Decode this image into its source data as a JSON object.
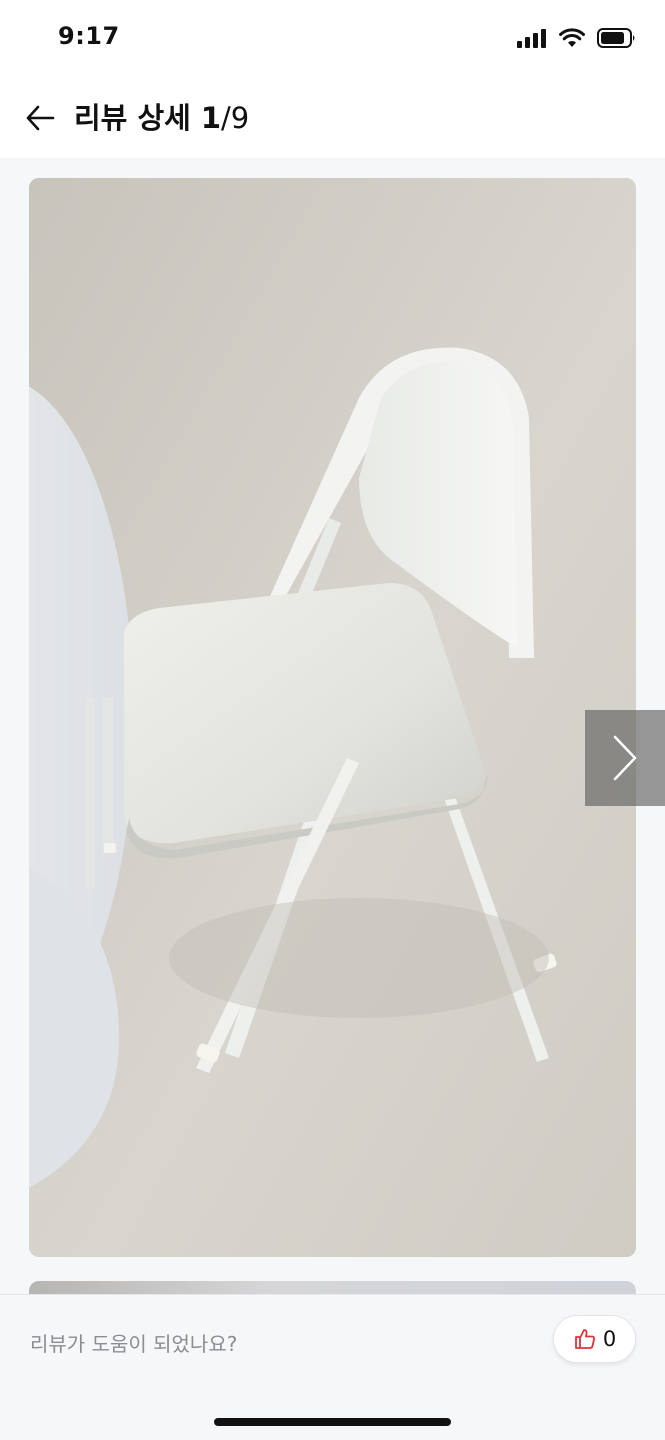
{
  "status_bar": {
    "time": "9:17",
    "icons": [
      "cellular-signal-icon",
      "wifi-icon",
      "battery-icon"
    ]
  },
  "header": {
    "back_icon": "arrow-left-icon",
    "title": "리뷰 상세",
    "current": "1",
    "total": "/9"
  },
  "photo": {
    "subject": "white-folding-chair-photo",
    "next_icon": "chevron-right-icon"
  },
  "footer": {
    "helpful_question": "리뷰가 도움이 되었나요?",
    "like_icon": "thumbs-up-icon",
    "like_count": "0"
  },
  "colors": {
    "like_icon": "#e0323a",
    "footer_bg": "#f6f7f9",
    "muted_text": "#8a8d93"
  }
}
